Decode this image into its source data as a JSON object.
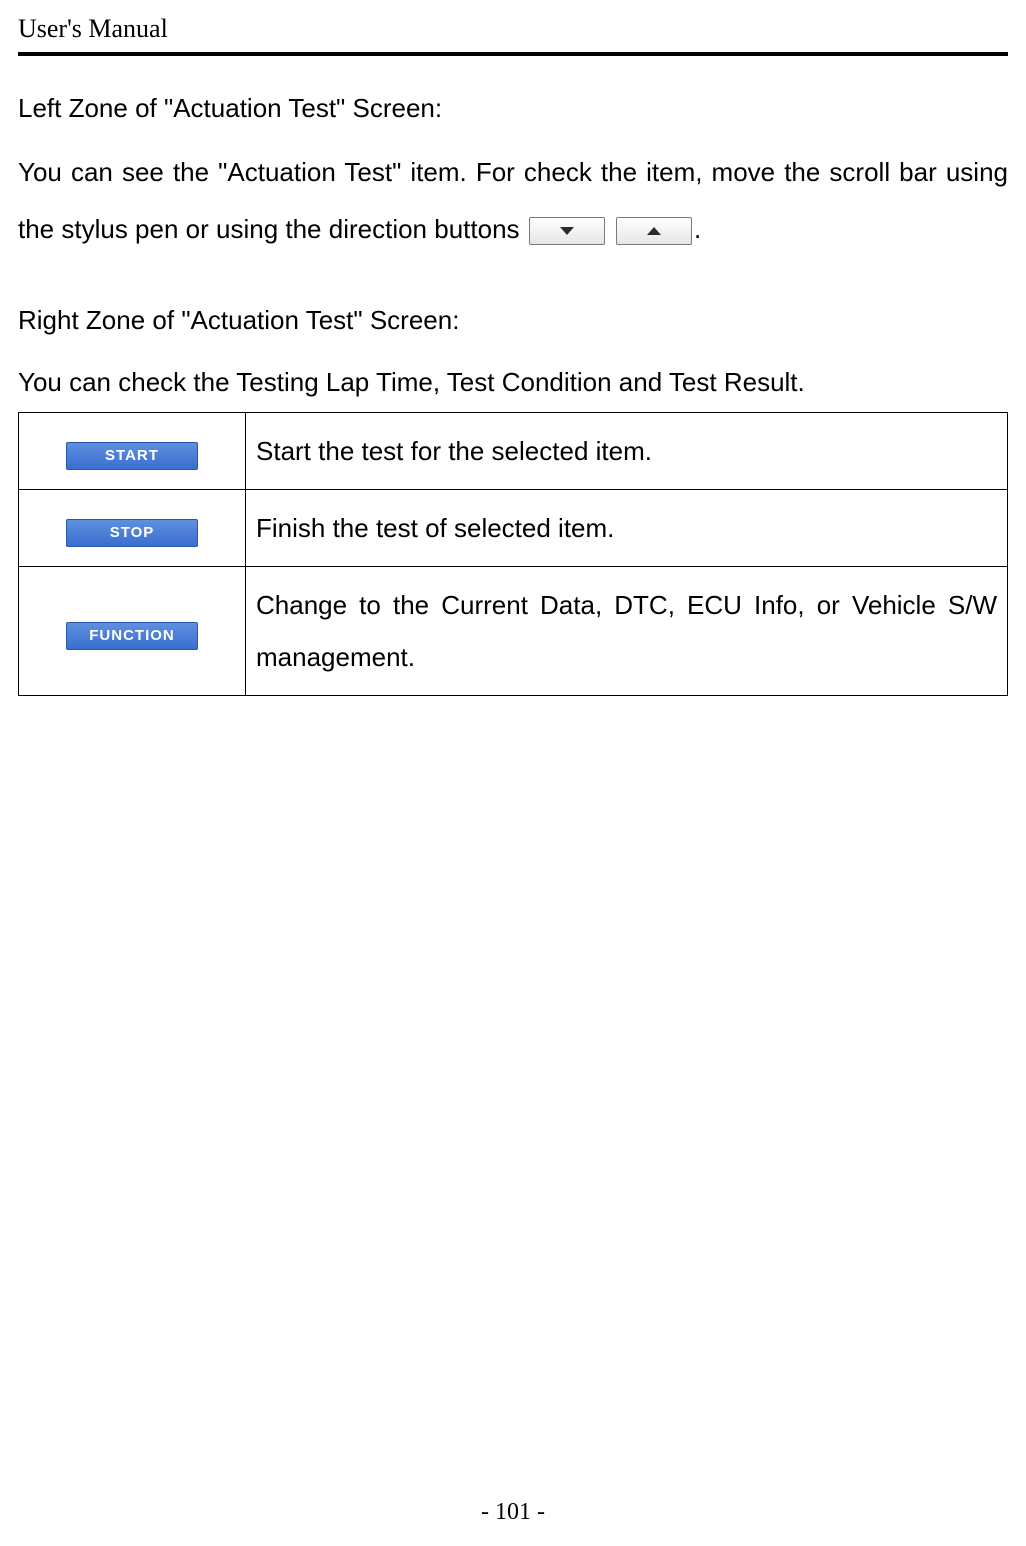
{
  "header": {
    "running_title": "User's Manual"
  },
  "leftZone": {
    "heading": "Left Zone of \"Actuation Test\" Screen:",
    "para_part1": "You can see the \"Actuation Test\" item. For check the item, move the scroll bar using the stylus pen or using the direction buttons ",
    "period": "."
  },
  "rightZone": {
    "heading": "Right Zone of \"Actuation Test\" Screen:",
    "intro": "You can check the Testing Lap Time, Test Condition and Test Result."
  },
  "buttonsTable": {
    "rows": [
      {
        "button_label": "START",
        "description": "Start the test for the selected item."
      },
      {
        "button_label": "STOP",
        "description": "Finish the test of selected item."
      },
      {
        "button_label": "FUNCTION",
        "description": "Change to the Current Data, DTC, ECU Info, or Vehicle S/W management."
      }
    ]
  },
  "footer": {
    "page_number": "- 101 -"
  }
}
